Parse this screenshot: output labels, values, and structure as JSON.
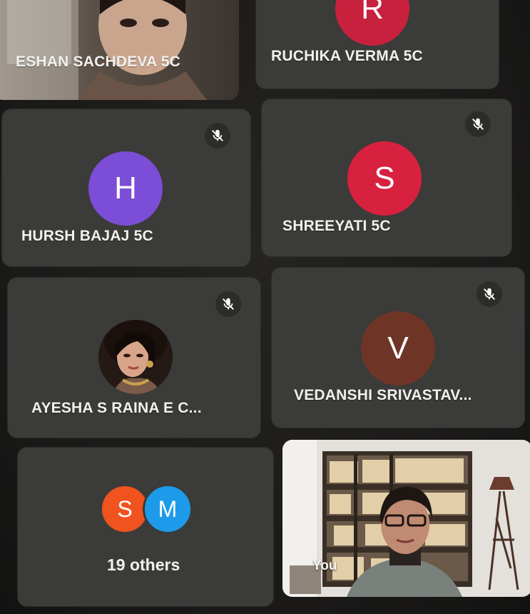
{
  "meeting": {
    "participants": [
      {
        "name": "ESHAN SACHDEVA 5C",
        "type": "video"
      },
      {
        "name": "RUCHIKA VERMA 5C",
        "initial": "R",
        "avatar_color": "#c8213d"
      },
      {
        "name": "HURSH BAJAJ 5C",
        "initial": "H",
        "avatar_color": "#7c4dd6",
        "muted": true
      },
      {
        "name": "SHREEYATI 5C",
        "initial": "S",
        "avatar_color": "#d8203f",
        "muted": true
      },
      {
        "name": "AYESHA S RAINA E C...",
        "type": "photo",
        "muted": true
      },
      {
        "name": "VEDANSHI SRIVASTAV...",
        "initial": "V",
        "avatar_color": "#6e3526",
        "muted": true
      }
    ],
    "others": {
      "label": "19 others",
      "avatars": [
        {
          "initial": "S",
          "color": "#f0531e"
        },
        {
          "initial": "M",
          "color": "#1d9bea"
        }
      ]
    },
    "self_tile": {
      "label": "You"
    },
    "icons": {
      "mute": "microphone-off-icon"
    }
  }
}
